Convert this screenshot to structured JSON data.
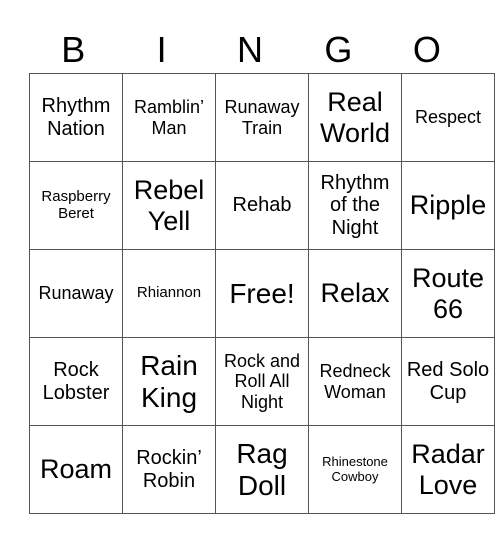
{
  "header": [
    "B",
    "I",
    "N",
    "G",
    "O"
  ],
  "cells": [
    [
      "Rhythm Nation",
      "Ramblin’ Man",
      "Runaway Train",
      "Real World",
      "Respect"
    ],
    [
      "Raspberry Beret",
      "Rebel Yell",
      "Rehab",
      "Rhythm of the Night",
      "Ripple"
    ],
    [
      "Runaway",
      "Rhiannon",
      "Free!",
      "Relax",
      "Route 66"
    ],
    [
      "Rock Lobster",
      "Rain King",
      "Rock and Roll All Night",
      "Redneck Woman",
      "Red Solo Cup"
    ],
    [
      "Roam",
      "Rockin’ Robin",
      "Rag Doll",
      "Rhinestone Cowboy",
      "Radar Love"
    ]
  ]
}
